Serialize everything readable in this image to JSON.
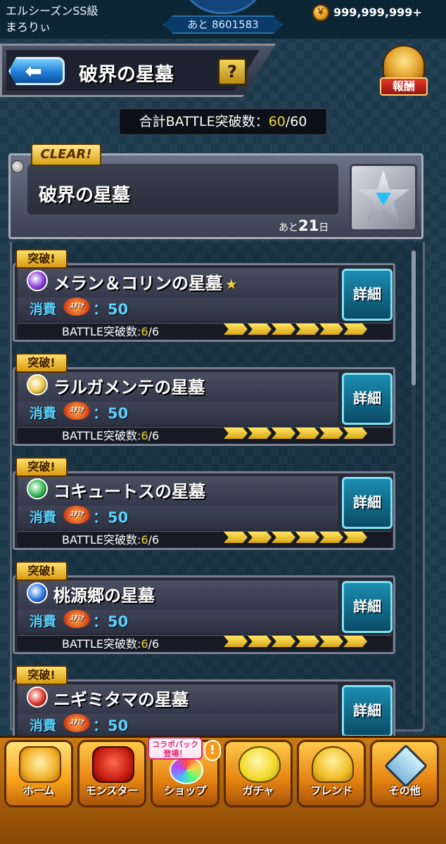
{
  "status": {
    "rank": "エルシーズンSS級",
    "username": "まろりぃ",
    "exp_remaining": "あと 8601583",
    "coins": "999,999,999+"
  },
  "header": {
    "title": "破界の星墓",
    "help_label": "?",
    "reward_label": "報酬"
  },
  "total": {
    "label": "合計BATTLE突破数：",
    "current": "60",
    "separator": "/",
    "max": "60"
  },
  "featured": {
    "badge": "CLEAR!",
    "title": "破界の星墓",
    "remaining_prefix": "あと",
    "remaining_days": "21",
    "remaining_suffix": "日"
  },
  "quests": [
    {
      "badge": "突破!",
      "title": "メラン＆コリンの星墓",
      "star": "★",
      "element_color": "#8a3ad8",
      "cost_label": "消費",
      "stamina_label": "ｽﾀﾐﾅ",
      "cost": "：50",
      "battle_label": "BATTLE突破数:",
      "battle_done": "6",
      "battle_total": "/6",
      "progress": 1.0,
      "detail_label": "詳細"
    },
    {
      "badge": "突破!",
      "title": "ラルガメンテの星墓",
      "star": "",
      "element_color": "#e8c440",
      "cost_label": "消費",
      "stamina_label": "ｽﾀﾐﾅ",
      "cost": "：50",
      "battle_label": "BATTLE突破数:",
      "battle_done": "6",
      "battle_total": "/6",
      "progress": 1.0,
      "detail_label": "詳細"
    },
    {
      "badge": "突破!",
      "title": "コキュートスの星墓",
      "star": "",
      "element_color": "#2fb84a",
      "cost_label": "消費",
      "stamina_label": "ｽﾀﾐﾅ",
      "cost": "：50",
      "battle_label": "BATTLE突破数:",
      "battle_done": "6",
      "battle_total": "/6",
      "progress": 1.0,
      "detail_label": "詳細"
    },
    {
      "badge": "突破!",
      "title": "桃源郷の星墓",
      "star": "",
      "element_color": "#2a74e0",
      "cost_label": "消費",
      "stamina_label": "ｽﾀﾐﾅ",
      "cost": "：50",
      "battle_label": "BATTLE突破数:",
      "battle_done": "6",
      "battle_total": "/6",
      "progress": 1.0,
      "detail_label": "詳細"
    },
    {
      "badge": "突破!",
      "title": "ニギミタマの星墓",
      "star": "",
      "element_color": "#e0342a",
      "cost_label": "消費",
      "stamina_label": "ｽﾀﾐﾅ",
      "cost": "：50",
      "battle_label": "",
      "battle_done": "",
      "battle_total": "",
      "progress": 0,
      "detail_label": "詳細"
    }
  ],
  "nav": {
    "home": "ホーム",
    "monster": "モンスター",
    "shop": "ショップ",
    "shop_tag": "コラボパック 登場！",
    "shop_alert": "!",
    "gacha": "ガチャ",
    "friend": "フレンド",
    "other": "その他"
  },
  "colors": {
    "accent_yellow": "#f5d33a",
    "cost_cyan": "#5ad3ff",
    "detail_teal": "#1b8db0",
    "nav_orange": "#e68412"
  }
}
